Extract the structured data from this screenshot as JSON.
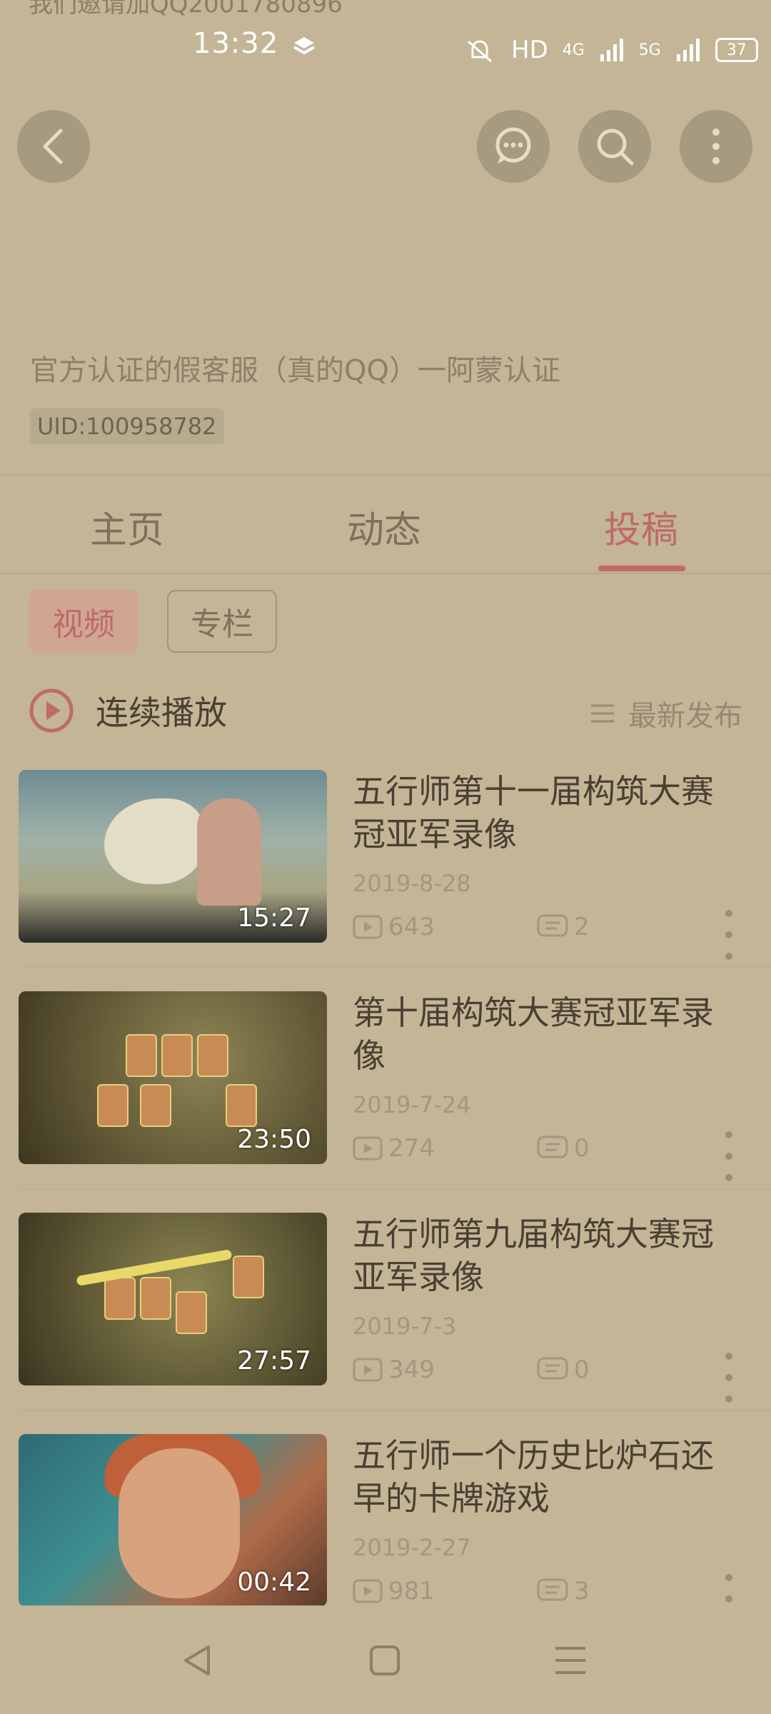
{
  "top_cut_text": "我们邀请加QQ2001780896",
  "status_bar": {
    "time": "13:32",
    "hd_label": "HD",
    "net1": "4G",
    "net2": "5G",
    "battery": "37"
  },
  "header": {
    "back_icon": "back-arrow-icon",
    "message_icon": "message-icon",
    "search_icon": "search-icon",
    "more_icon": "more-vertical-icon"
  },
  "profile": {
    "bio": "官方认证的假客服（真的QQ）一阿蒙认证",
    "uid": "UID:100958782"
  },
  "tabs": [
    {
      "label": "主页",
      "active": false
    },
    {
      "label": "动态",
      "active": false
    },
    {
      "label": "投稿",
      "active": true
    }
  ],
  "filters": {
    "video": "视频",
    "column": "专栏"
  },
  "playlist": {
    "continuous_play": "连续播放",
    "sort_label": "最新发布"
  },
  "videos": [
    {
      "title": "五行师第十一届构筑大赛冠亚军录像",
      "date": "2019-8-28",
      "duration": "15:27",
      "views": "643",
      "comments": "2"
    },
    {
      "title": "第十届构筑大赛冠亚军录像",
      "date": "2019-7-24",
      "duration": "23:50",
      "views": "274",
      "comments": "0"
    },
    {
      "title": "五行师第九届构筑大赛冠亚军录像",
      "date": "2019-7-3",
      "duration": "27:57",
      "views": "349",
      "comments": "0"
    },
    {
      "title": "五行师一个历史比炉石还早的卡牌游戏",
      "date": "2019-2-27",
      "duration": "00:42",
      "views": "981",
      "comments": "3"
    }
  ],
  "colors": {
    "background": "#c3b596",
    "accent": "#c0696a"
  }
}
